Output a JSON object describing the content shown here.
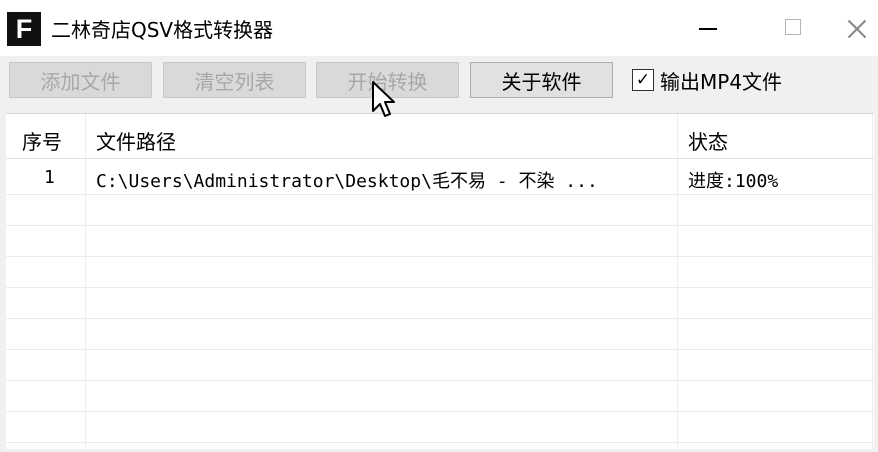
{
  "window": {
    "icon_letter": "F",
    "title": "二林奇店QSV格式转换器"
  },
  "toolbar": {
    "add_file_label": "添加文件",
    "clear_list_label": "清空列表",
    "start_convert_label": "开始转换",
    "about_label": "关于软件",
    "output_mp4_label": "输出MP4文件",
    "output_mp4_checked": true
  },
  "table": {
    "columns": [
      "序号",
      "文件路径",
      "状态"
    ],
    "rows": [
      {
        "index": "1",
        "path": "C:\\Users\\Administrator\\Desktop\\毛不易 - 不染 ...",
        "status": "进度:100%"
      }
    ]
  }
}
